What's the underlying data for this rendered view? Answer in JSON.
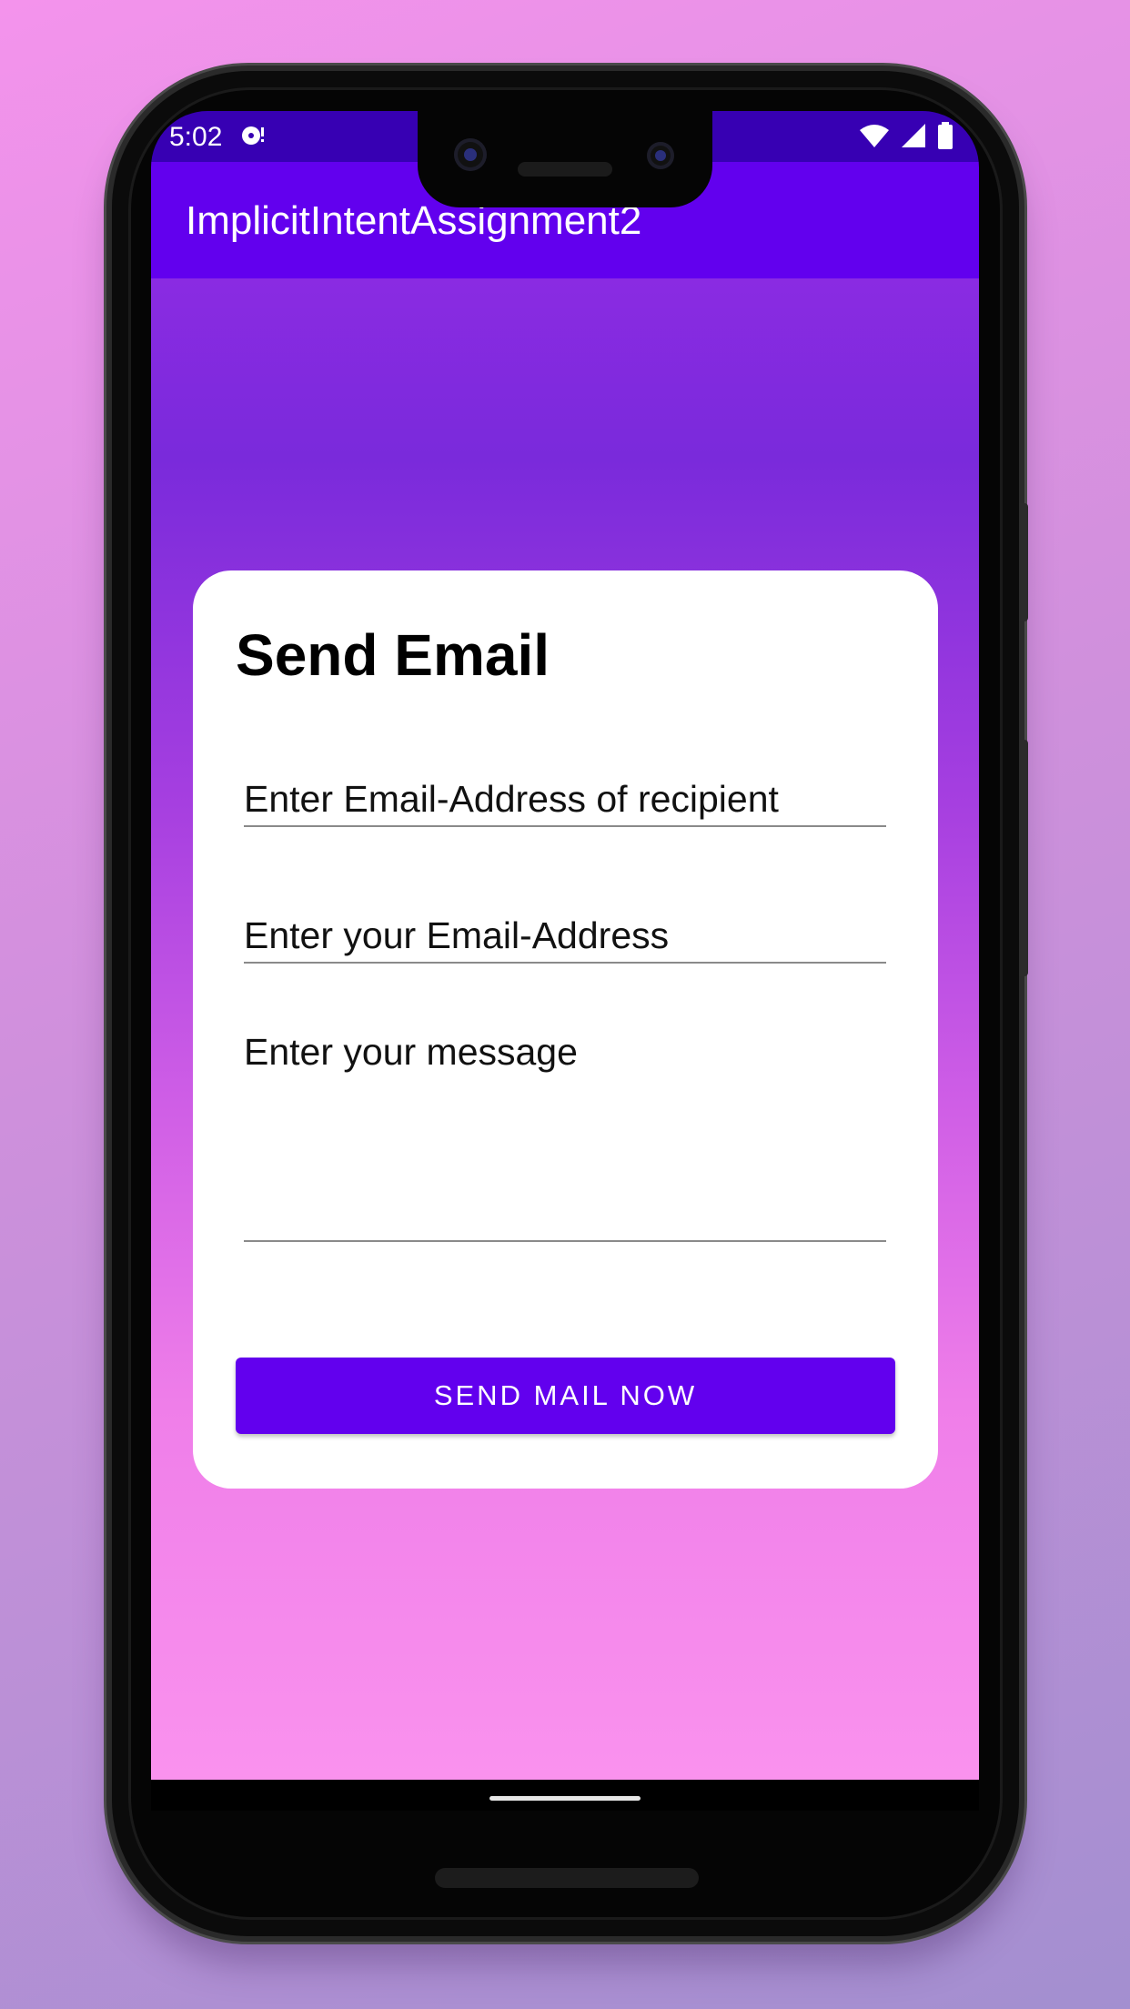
{
  "status_bar": {
    "time": "5:02",
    "notification_icon": "download-notification-icon",
    "icons": [
      "wifi-icon",
      "signal-icon",
      "battery-icon"
    ]
  },
  "app_bar": {
    "title": "ImplicitIntentAssignment2",
    "color": "#6200ee"
  },
  "card": {
    "title": "Send Email",
    "recipient_placeholder": "Enter Email-Address of recipient",
    "sender_placeholder": "Enter your Email-Address",
    "message_placeholder": "Enter your message",
    "send_label": "SEND MAIL NOW"
  },
  "colors": {
    "accent": "#6200ee",
    "status_bar": "#3700b3"
  }
}
